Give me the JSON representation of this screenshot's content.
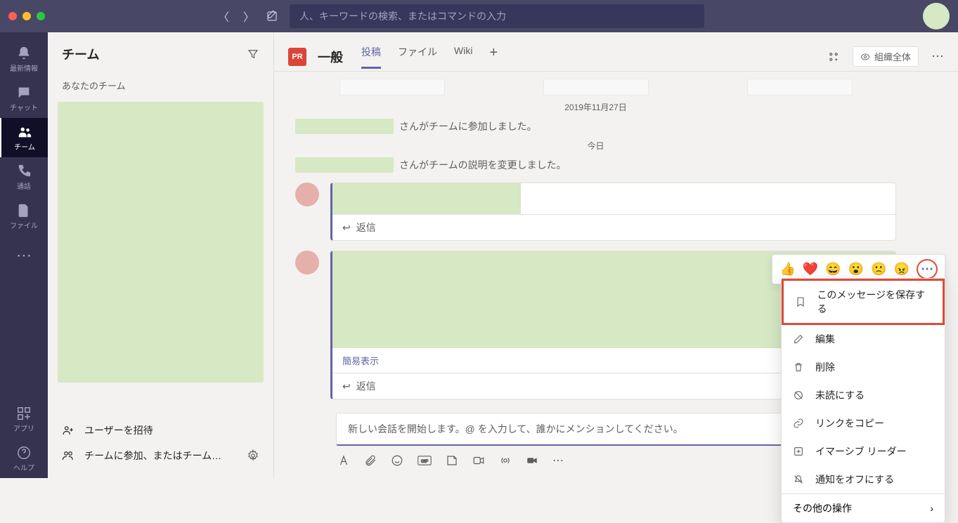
{
  "search": {
    "placeholder": "人、キーワードの検索、またはコマンドの入力"
  },
  "rail": {
    "items": [
      {
        "icon": "bell-icon",
        "label": "最新情報"
      },
      {
        "icon": "chat-icon",
        "label": "チャット"
      },
      {
        "icon": "teams-icon",
        "label": "チーム"
      },
      {
        "icon": "call-icon",
        "label": "通話"
      },
      {
        "icon": "file-icon",
        "label": "ファイル"
      }
    ],
    "apps": "アプリ",
    "help": "ヘルプ"
  },
  "sidebar": {
    "title": "チーム",
    "section": "あなたのチーム",
    "invite": "ユーザーを招待",
    "join": "チームに参加、またはチーム…"
  },
  "channel": {
    "badge": "PR",
    "name": "一般",
    "tabs": [
      "投稿",
      "ファイル",
      "Wiki"
    ],
    "org": "組織全体"
  },
  "messages": {
    "date1": "2019年11月27日",
    "date2": "今日",
    "joined": "さんがチームに参加しました。",
    "changed": "さんがチームの説明を変更しました。",
    "reply": "返信",
    "simple_view": "簡易表示"
  },
  "context_menu": {
    "save": "このメッセージを保存する",
    "edit": "編集",
    "delete": "削除",
    "unread": "未読にする",
    "copy_link": "リンクをコピー",
    "immersive": "イマーシブ リーダー",
    "mute": "通知をオフにする",
    "more": "その他の操作"
  },
  "compose": {
    "placeholder": "新しい会話を開始します。@ を入力して、誰かにメンションしてください。"
  }
}
